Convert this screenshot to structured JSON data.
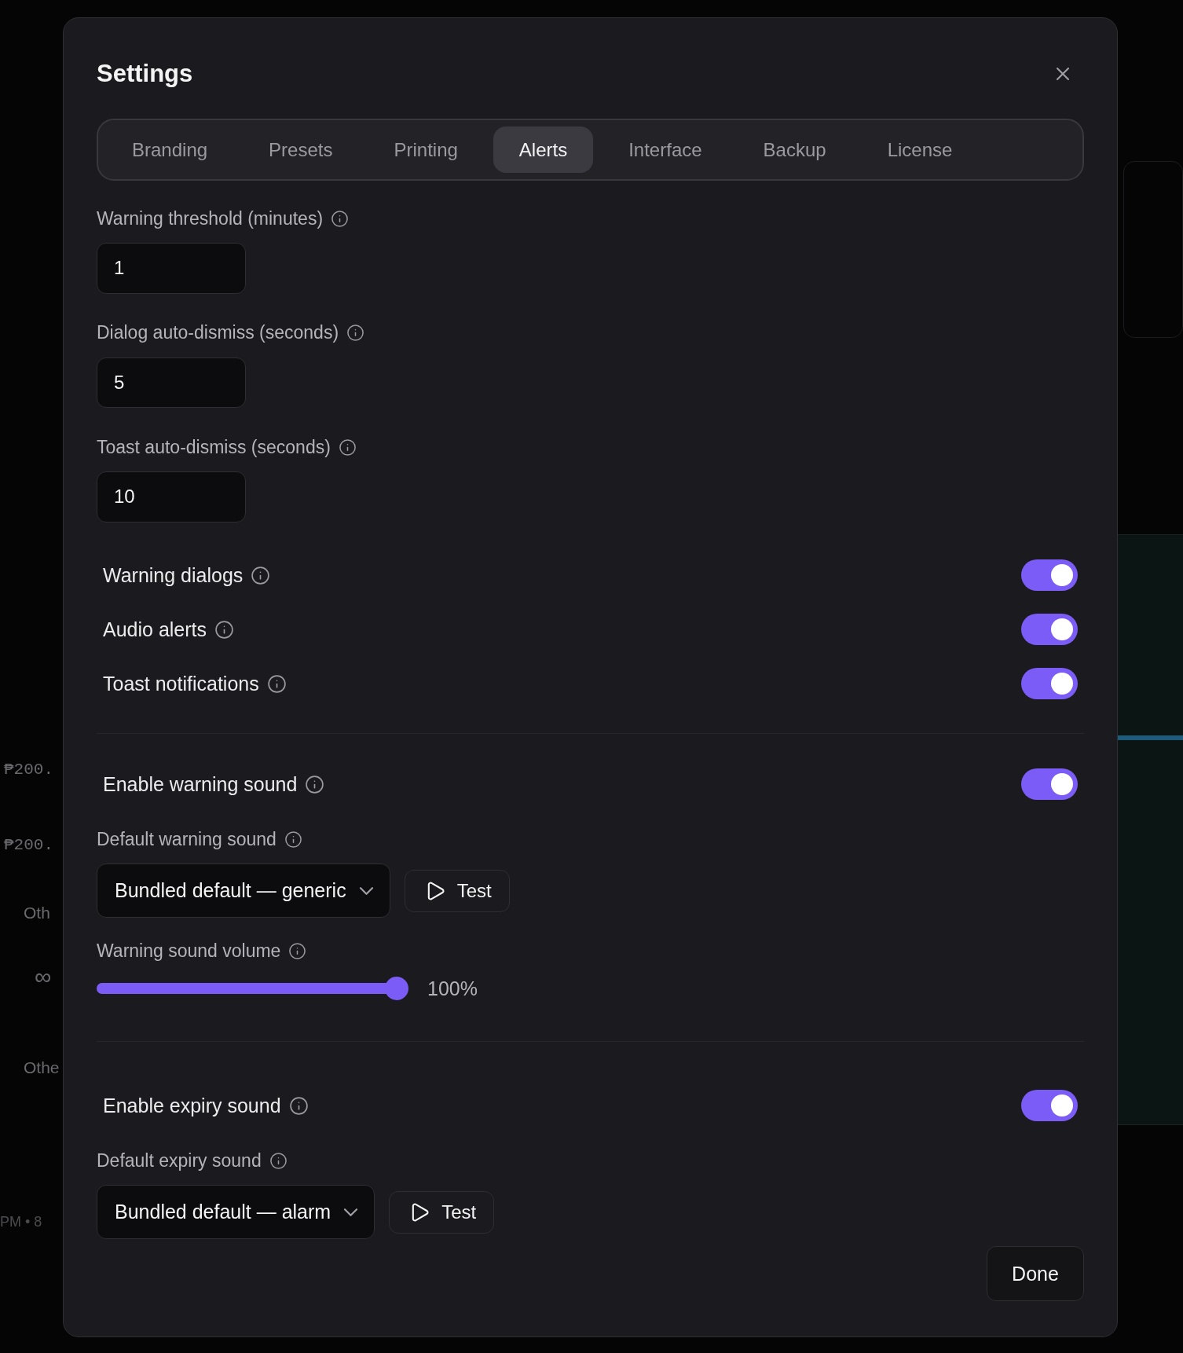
{
  "background": {
    "fragments": [
      {
        "kind": "price",
        "text": "₱200."
      },
      {
        "kind": "price",
        "text": "₱200."
      },
      {
        "kind": "label",
        "text": "Oth"
      },
      {
        "kind": "symbol",
        "text": "∞"
      },
      {
        "kind": "label",
        "text": "Othe"
      },
      {
        "kind": "meta",
        "text": "PM  • 8"
      }
    ]
  },
  "dialog": {
    "title": "Settings"
  },
  "tabs": [
    {
      "label": "Branding",
      "selected": false
    },
    {
      "label": "Presets",
      "selected": false
    },
    {
      "label": "Printing",
      "selected": false
    },
    {
      "label": "Alerts",
      "selected": true
    },
    {
      "label": "Interface",
      "selected": false
    },
    {
      "label": "Backup",
      "selected": false
    },
    {
      "label": "License",
      "selected": false
    }
  ],
  "number_fields": [
    {
      "label": "Warning threshold (minutes)",
      "value": "1"
    },
    {
      "label": "Dialog auto-dismiss (seconds)",
      "value": "5"
    },
    {
      "label": "Toast auto-dismiss (seconds)",
      "value": "10"
    }
  ],
  "toggles": [
    {
      "label": "Warning dialogs",
      "on": true
    },
    {
      "label": "Audio alerts",
      "on": true
    },
    {
      "label": "Toast notifications",
      "on": true
    }
  ],
  "sound_sections": [
    {
      "toggle": {
        "label": "Enable warning sound",
        "on": true
      },
      "select_label": "Default warning sound",
      "select_value": "Bundled default — generic",
      "test_button": "Test",
      "volume": {
        "label": "Warning sound volume",
        "level": 1.0,
        "reading": "100%"
      }
    },
    {
      "toggle": {
        "label": "Enable expiry sound",
        "on": true
      },
      "select_label": "Default expiry sound",
      "select_value": "Bundled default — alarm",
      "test_button": "Test"
    }
  ],
  "footer": {
    "done_button": "Done"
  }
}
